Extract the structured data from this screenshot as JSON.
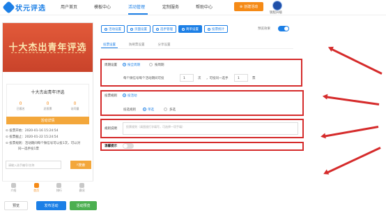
{
  "header": {
    "logo_text": "状元评选",
    "nav": [
      "用户首页",
      "模板中心",
      "活动管理",
      "定制服务",
      "帮助中心"
    ],
    "active_nav": "活动管理",
    "create_button": "创建活动",
    "user_label": "锐程升级"
  },
  "preview": {
    "banner_title": "十大杰出青年评选",
    "card_title": "十大杰出青年评选",
    "stats": [
      {
        "num": "0",
        "label": "已报名"
      },
      {
        "num": "0",
        "label": "总投票"
      },
      {
        "num": "0",
        "label": "访问量"
      }
    ],
    "signup_button": "活动详情",
    "info": [
      "投票开始：2020-01-16 15:24:54",
      "投票截止：2020-01-22 15:24:54",
      "投票规则：活动期间每个微信号可以投1次，可以对",
      "同一选手投1票"
    ],
    "search_placeholder": "请输入选手编号/名称",
    "search_button": "搜索",
    "tabs": [
      "介绍",
      "首页",
      "排行",
      "赛况"
    ]
  },
  "footer": {
    "preview": "预览",
    "publish": "发布活动",
    "stop": "活动预览"
  },
  "toolbar": {
    "buttons": [
      "活动设置",
      "页面设置",
      "选手管理",
      "简单设置",
      "投票统计"
    ],
    "active": "简单设置",
    "preview_label": "预览效果",
    "preview_toggle_on": true
  },
  "subtabs": [
    "投票设置",
    "防刷票设置",
    "分享设置"
  ],
  "form": {
    "period": {
      "label": "周期设置",
      "option1": "按全周期",
      "option2": "按周期",
      "text1": "每个微信号每个活动期间可投",
      "times_value": "1",
      "times_unit": "次",
      "text2": "，可投同一选手",
      "votes_value": "1",
      "votes_unit": "票"
    },
    "rule": {
      "label": "投票规则",
      "option": "投活动",
      "sublabel": "投选规则",
      "single": "单选",
      "multi": "多选"
    },
    "note": {
      "label": "规则说明",
      "placeholder": "投票规则（请直接打字填写，可选择一项手填）"
    },
    "tip": {
      "label": "温馨提示",
      "toggle_on": false
    }
  },
  "colors": {
    "primary": "#1c7fe6",
    "orange": "#f58a16",
    "highlight_red": "#d52b2b",
    "banner_red": "#d24a2f"
  }
}
